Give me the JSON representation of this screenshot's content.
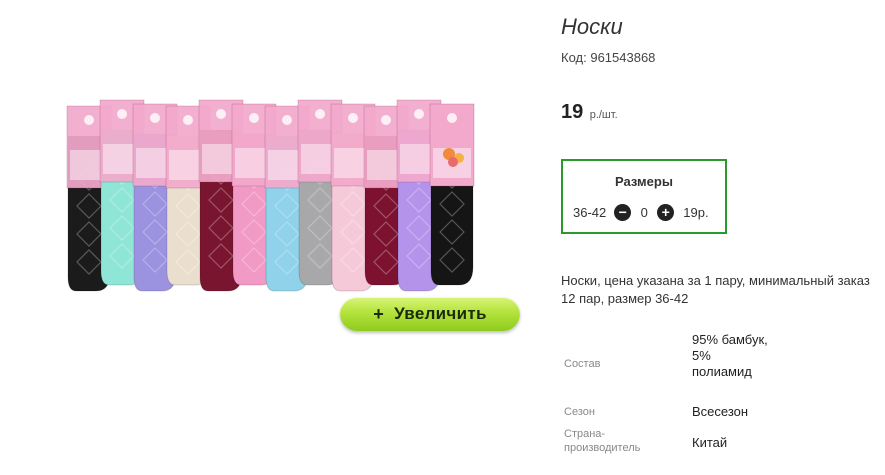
{
  "product": {
    "title": "Носки",
    "code_label": "Код:",
    "code_value": "961543868",
    "price_value": "19",
    "price_unit": "р./шт."
  },
  "image": {
    "zoom_plus": "+",
    "zoom_label": "Увеличить",
    "sock_colors": [
      "#1b1b1b",
      "#8fe6d6",
      "#9b92e0",
      "#eadfcf",
      "#7a1530",
      "#f29ac6",
      "#8fd2ea",
      "#a8a8aa",
      "#f6c9d8",
      "#7c1230",
      "#b394ea",
      "#151515"
    ]
  },
  "sizes": {
    "title": "Размеры",
    "row": {
      "size": "36-42",
      "minus": "−",
      "quantity": "0",
      "plus": "+",
      "price": "19р."
    }
  },
  "description": "Носки, цена указана за 1 пару, минимальный заказ 12 пар, размер 36-42",
  "properties": [
    {
      "key": "Состав",
      "value": "95% бамбук, 5% полиамид"
    },
    {
      "key": "Сезон",
      "value": "Всесезон"
    },
    {
      "key": "Страна-производитель",
      "value": "Китай"
    }
  ],
  "colors": {
    "sizes_border": "#2a9a2a",
    "zoom_button": "#b3e33c",
    "label_pink": "#f3a9cc"
  }
}
